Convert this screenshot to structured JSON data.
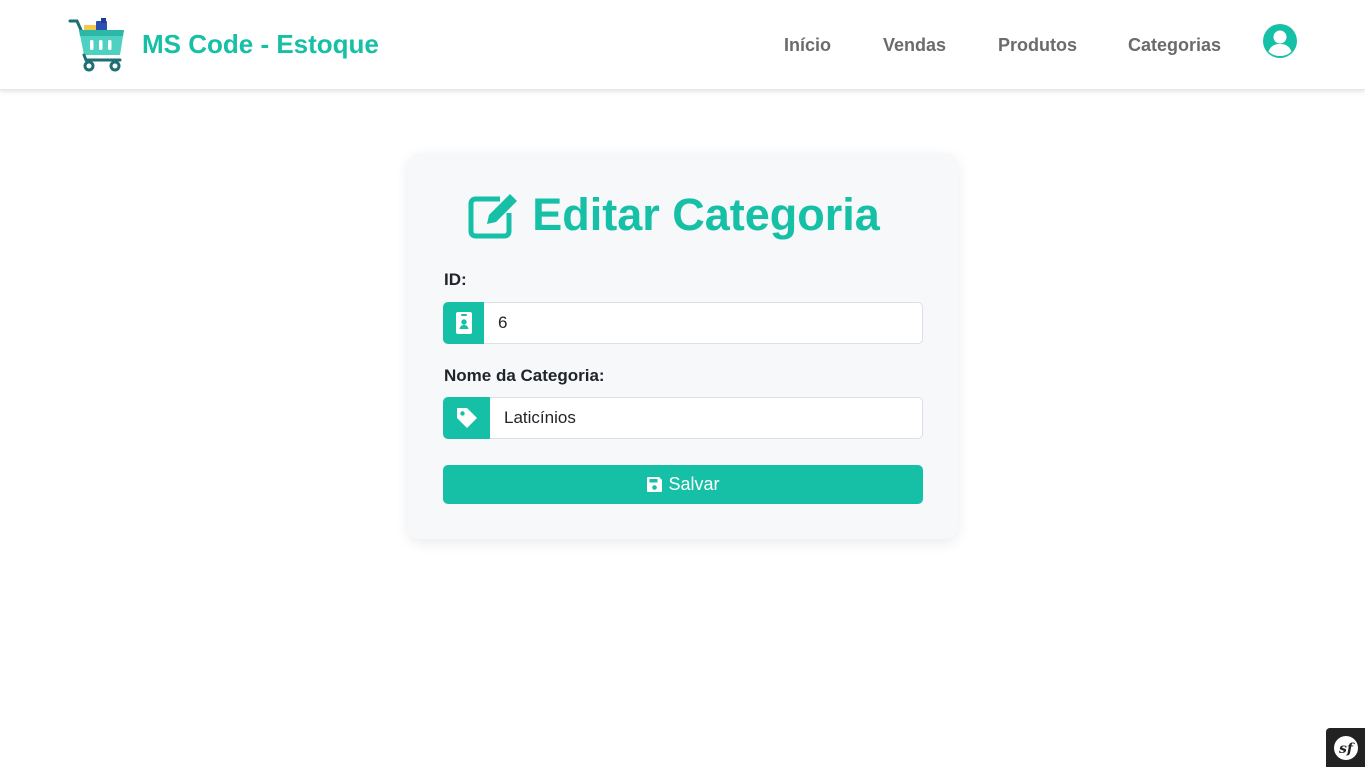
{
  "brand": {
    "name": "MS Code - Estoque",
    "icon": "shopping-cart-icon"
  },
  "nav": {
    "links": [
      "Início",
      "Vendas",
      "Produtos",
      "Categorias"
    ],
    "user_icon": "user-circle-icon"
  },
  "form": {
    "title": "Editar Categoria",
    "title_icon": "edit-icon",
    "id_label": "ID:",
    "id_value": "6",
    "id_icon": "id-badge-icon",
    "name_label": "Nome da Categoria:",
    "name_value": "Laticínios",
    "name_icon": "tag-icon",
    "save_label": "Salvar",
    "save_icon": "floppy-disk-icon"
  },
  "colors": {
    "accent": "#16c0a6",
    "nav_text": "#6b6b6b",
    "card_bg": "#f6f8fa"
  },
  "footer": {
    "badge_icon": "symfony-icon"
  }
}
